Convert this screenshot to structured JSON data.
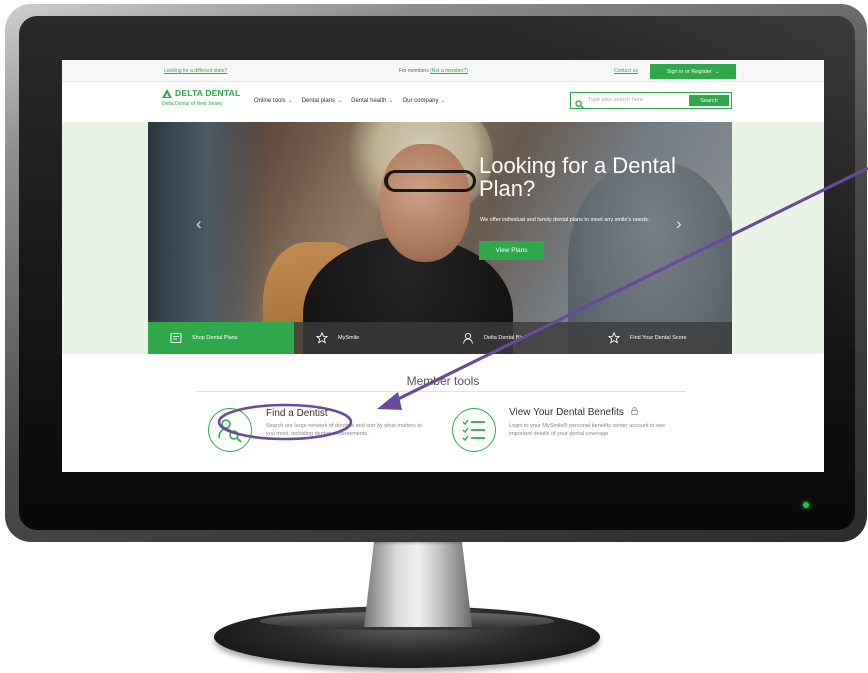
{
  "colors": {
    "brand_green": "#2ea84a",
    "annotation_purple": "#6a4a9a"
  },
  "util_bar": {
    "state_link": "Looking for a different state?",
    "members_prefix": "For members ",
    "members_link": "(Not a member?)",
    "contact_link": "Contact us",
    "signin_label": "Sign in or Register"
  },
  "header": {
    "logo_text": "DELTA DENTAL",
    "logo_sub": "Delta Dental of New Jersey",
    "nav": [
      {
        "label": "Online tools"
      },
      {
        "label": "Dental plans"
      },
      {
        "label": "Dental health"
      },
      {
        "label": "Our company"
      }
    ],
    "search_placeholder": "Type your search here",
    "search_button": "Search"
  },
  "hero": {
    "title": "Looking for a Dental Plan?",
    "description": "We offer individual and family dental plans to meet any smile's needs.",
    "cta": "View Plans",
    "tiles": [
      {
        "label": "Shop Dental Plans",
        "icon": "document-icon"
      },
      {
        "label": "MySmile",
        "icon": "star-icon"
      },
      {
        "label": "Delta Dental Blo",
        "icon": "person-icon"
      },
      {
        "label": "Find Your Dental Score",
        "icon": "star-icon"
      }
    ]
  },
  "member_tools": {
    "title": "Member tools",
    "tools": [
      {
        "title": "Find a Dentist",
        "description": "Search our large network of dentists and sort by what matters to you most, including dentist endorsements.",
        "icon": "dentist-search-icon"
      },
      {
        "title": "View Your Dental Benefits",
        "description": "Login to your MySmile® personal benefits center account to see important details of your dental coverage",
        "icon": "checklist-icon"
      }
    ]
  }
}
